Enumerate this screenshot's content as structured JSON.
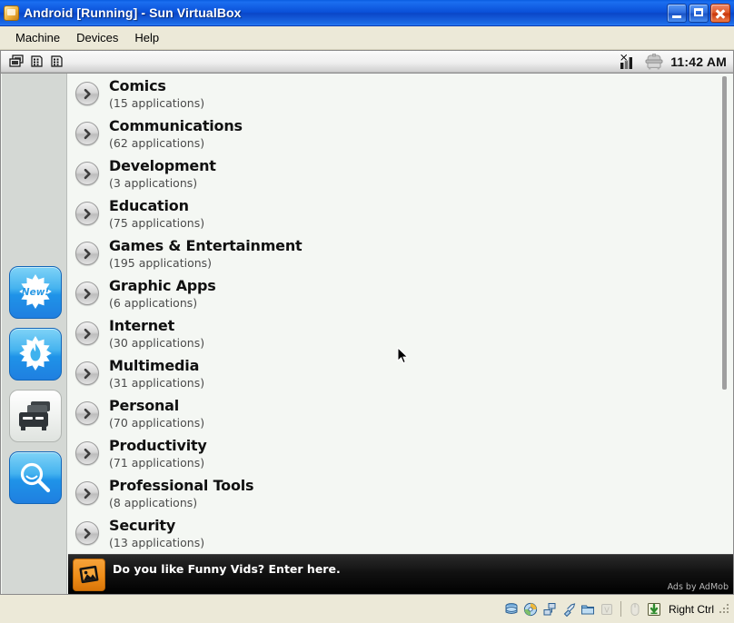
{
  "window": {
    "title": "Android [Running] - Sun VirtualBox",
    "icon": "virtualbox-vm-icon",
    "controls": [
      {
        "name": "minimize-button",
        "label": "Minimize"
      },
      {
        "name": "maximize-button",
        "label": "Maximize"
      },
      {
        "name": "close-button",
        "label": "Close"
      }
    ]
  },
  "menubar": {
    "items": [
      {
        "label": "Machine",
        "name": "menu-machine"
      },
      {
        "label": "Devices",
        "name": "menu-devices"
      },
      {
        "label": "Help",
        "name": "menu-help"
      }
    ]
  },
  "android_status": {
    "notification_icons": [
      "multi-window-icon",
      "sim-card-icon",
      "sim-card-icon"
    ],
    "signal_icon": "signal-no-service-icon",
    "alarm_icon": "alarm-clock-icon",
    "clock": "11:42 AM"
  },
  "sidebar": {
    "tabs": [
      {
        "name": "tab-new",
        "icon": "new-burst-icon",
        "label": "New!",
        "selected": false
      },
      {
        "name": "tab-hot",
        "icon": "flame-burst-icon",
        "label": "Hot",
        "selected": false
      },
      {
        "name": "tab-categories",
        "icon": "categories-archive-icon",
        "label": "Categories",
        "selected": true
      },
      {
        "name": "tab-search",
        "icon": "search-magnifier-icon",
        "label": "Search",
        "selected": false
      }
    ]
  },
  "categories": [
    {
      "name": "Comics",
      "count": "(15 applications)"
    },
    {
      "name": "Communications",
      "count": "(62 applications)"
    },
    {
      "name": "Development",
      "count": "(3 applications)"
    },
    {
      "name": "Education",
      "count": "(75 applications)"
    },
    {
      "name": "Games & Entertainment",
      "count": "(195 applications)"
    },
    {
      "name": "Graphic Apps",
      "count": "(6 applications)"
    },
    {
      "name": "Internet",
      "count": "(30 applications)"
    },
    {
      "name": "Multimedia",
      "count": "(31 applications)"
    },
    {
      "name": "Personal",
      "count": "(70 applications)"
    },
    {
      "name": "Productivity",
      "count": "(71 applications)"
    },
    {
      "name": "Professional Tools",
      "count": "(8 applications)"
    },
    {
      "name": "Security",
      "count": "(13 applications)"
    }
  ],
  "ad": {
    "icon": "photo-frame-icon",
    "text": "Do you like Funny Vids? Enter here.",
    "attribution": "Ads by AdMob"
  },
  "vbox_status": {
    "icons": [
      {
        "name": "hard-disk-icon",
        "enabled": true
      },
      {
        "name": "cd-dvd-icon",
        "enabled": true
      },
      {
        "name": "network-adapter-icon",
        "enabled": true
      },
      {
        "name": "usb-icon",
        "enabled": true
      },
      {
        "name": "shared-folders-icon",
        "enabled": true
      },
      {
        "name": "remote-display-icon",
        "enabled": false
      },
      {
        "name": "mouse-integration-icon",
        "enabled": false
      },
      {
        "name": "host-key-icon",
        "enabled": true
      }
    ],
    "host_key": "Right Ctrl"
  },
  "colors": {
    "title_blue": "#0a50d8",
    "chrome": "#ece9d8",
    "list_bg": "#f4f7f3",
    "sidebar_bg": "#d4d8d4",
    "accent_blue": "#1f93e8",
    "ad_orange": "#ef8d18"
  }
}
